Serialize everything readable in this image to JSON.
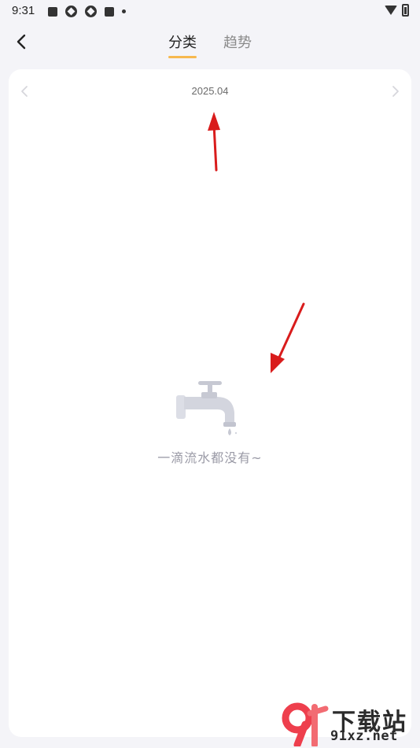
{
  "status_bar": {
    "time": "9:31",
    "left_icons": [
      "notification-square-icon",
      "app-round-icon",
      "app-round-icon",
      "notification-square-icon",
      "more-dot-icon"
    ],
    "right_icons": [
      "wifi-icon",
      "battery-icon"
    ]
  },
  "header": {
    "back_icon": "chevron-left-icon",
    "tabs": [
      {
        "label": "分类",
        "active": true
      },
      {
        "label": "趋势",
        "active": false
      }
    ],
    "accent_color": "#f7b94f"
  },
  "date_nav": {
    "date": "2025.04",
    "prev_icon": "chevron-left-icon",
    "next_icon": "chevron-right-icon"
  },
  "empty_state": {
    "icon": "faucet-icon",
    "message": "一滴流水都没有~"
  },
  "annotations": {
    "arrow_color": "#d91c1c"
  },
  "watermark": {
    "logo_text": "9f",
    "title": "下载站",
    "url": "91xz.net"
  }
}
